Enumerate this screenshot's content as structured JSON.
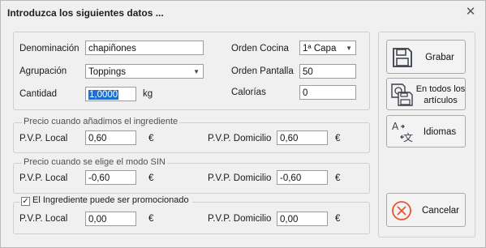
{
  "window": {
    "title": "Introduzca los siguientes datos ...",
    "close_glyph": "✕"
  },
  "main": {
    "denominacion_label": "Denominación",
    "denominacion_value": "chapiñones",
    "agrupacion_label": "Agrupación",
    "agrupacion_value": "Toppings",
    "cantidad_label": "Cantidad",
    "cantidad_value": "1,0000",
    "cantidad_unit": "kg",
    "orden_cocina_label": "Orden Cocina",
    "orden_cocina_value": "1ª Capa",
    "orden_pantalla_label": "Orden Pantalla",
    "orden_pantalla_value": "50",
    "calorias_label": "Calorías",
    "calorias_value": "0"
  },
  "groups": {
    "ingrediente": {
      "legend": "Precio cuando añadimos el ingrediente",
      "local_label": "P.V.P. Local",
      "local_value": "0,60",
      "domicilio_label": "P.V.P. Domicilio",
      "domicilio_value": "0,60",
      "currency": "€"
    },
    "sin": {
      "legend": "Precio cuando se elige el modo SIN",
      "local_label": "P.V.P. Local",
      "local_value": "-0,60",
      "domicilio_label": "P.V.P. Domicilio",
      "domicilio_value": "-0,60",
      "currency": "€"
    },
    "promocion": {
      "checkbox_label": "El Ingrediente puede ser promocionado",
      "checked": true,
      "local_label": "P.V.P. Local",
      "local_value": "0,00",
      "domicilio_label": "P.V.P. Domicilio",
      "domicilio_value": "0,00",
      "currency": "€"
    }
  },
  "buttons": {
    "grabar": "Grabar",
    "todos_line1": "En todos los",
    "todos_line2": "artículos",
    "idiomas": "Idiomas",
    "cancelar": "Cancelar"
  },
  "icons": {
    "grabar": "floppy-disk-icon",
    "todos": "multi-floppy-icon",
    "idiomas": "translate-icon",
    "cancelar": "cancel-circle-icon",
    "cancel_color": "#e8542f"
  }
}
